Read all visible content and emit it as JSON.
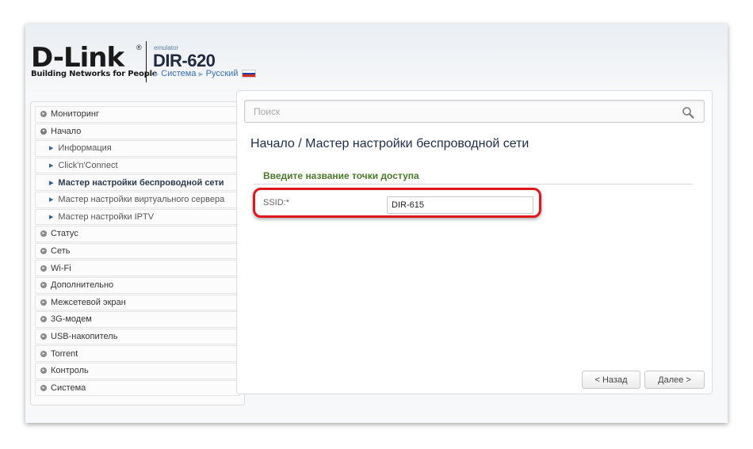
{
  "header": {
    "logo_text": "D-Link",
    "logo_reg": "®",
    "tagline": "Building Networks for People",
    "emulator_label": "emulator",
    "model": "DIR-620",
    "breadcrumb_system": "Система",
    "breadcrumb_language": "Русский",
    "flag_colors": [
      "#ffffff",
      "#1c3fa8",
      "#d52b1e"
    ]
  },
  "sidebar": {
    "items": [
      {
        "label": "Мониторинг",
        "level": 0,
        "expanded": false
      },
      {
        "label": "Начало",
        "level": 0,
        "expanded": true
      },
      {
        "label": "Информация",
        "level": 1
      },
      {
        "label": "Click'n'Connect",
        "level": 1
      },
      {
        "label": "Мастер настройки беспроводной сети",
        "level": 1,
        "active": true
      },
      {
        "label": "Мастер настройки виртуального сервера",
        "level": 1
      },
      {
        "label": "Мастер настройки IPTV",
        "level": 1
      },
      {
        "label": "Статус",
        "level": 0,
        "expanded": false
      },
      {
        "label": "Сеть",
        "level": 0,
        "expanded": false
      },
      {
        "label": "Wi-Fi",
        "level": 0,
        "expanded": false
      },
      {
        "label": "Дополнительно",
        "level": 0,
        "expanded": false
      },
      {
        "label": "Межсетевой экран",
        "level": 0,
        "expanded": false
      },
      {
        "label": "3G-модем",
        "level": 0,
        "expanded": false
      },
      {
        "label": "USB-накопитель",
        "level": 0,
        "expanded": false
      },
      {
        "label": "Torrent",
        "level": 0,
        "expanded": false
      },
      {
        "label": "Контроль",
        "level": 0,
        "expanded": false
      },
      {
        "label": "Система",
        "level": 0,
        "expanded": false
      }
    ]
  },
  "search": {
    "placeholder": "Поиск",
    "icon": "search-icon"
  },
  "main": {
    "page_title": "Начало /  Мастер настройки беспроводной сети",
    "section_title": "Введите название точки доступа",
    "ssid_label": "SSID:*",
    "ssid_value": "DIR-615",
    "back_label": "< Назад",
    "next_label": "Далее >"
  },
  "colors": {
    "accent_green": "#4b7a2a",
    "title_blue": "#1c2d4a",
    "highlight_red": "#e0161f"
  }
}
